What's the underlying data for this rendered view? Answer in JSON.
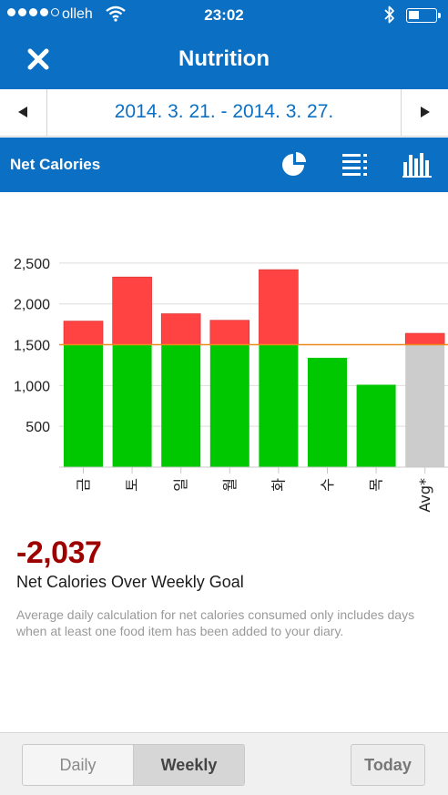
{
  "status": {
    "carrier": "olleh",
    "time": "23:02"
  },
  "nav": {
    "title": "Nutrition",
    "close_icon": "close-icon"
  },
  "date_range": {
    "label": "2014. 3. 21. - 2014. 3. 27.",
    "prev_icon": "chevron-left-icon",
    "next_icon": "chevron-right-icon"
  },
  "section": {
    "title": "Net Calories",
    "icons": [
      "pie-chart-icon",
      "list-icon",
      "bar-chart-icon"
    ]
  },
  "chart_data": {
    "type": "bar",
    "categories": [
      "금",
      "토",
      "일",
      "월",
      "화",
      "수",
      "목",
      "Avg*"
    ],
    "goal": 1500,
    "series": [
      {
        "name": "",
        "values": [
          1500,
          1500,
          1500,
          1500,
          1500,
          1340,
          1010,
          1500
        ]
      },
      {
        "name": "",
        "values": [
          290,
          830,
          380,
          300,
          920,
          0,
          0,
          140
        ]
      }
    ],
    "ylim": [
      0,
      2700
    ],
    "yticks": [
      500,
      1000,
      1500,
      2000,
      2500
    ],
    "ytick_labels": [
      "500",
      "1,000",
      "1,500",
      "2,000",
      "2,500"
    ],
    "colors": {
      "under_goal": "#00c800",
      "over_goal": "#ff4343",
      "average": "#cccccc",
      "goal_line": "#f08a1c"
    },
    "grid": true
  },
  "summary": {
    "value": "-2,037",
    "label": "Net Calories Over Weekly Goal",
    "note": "Average daily calculation for net calories consumed only includes days when at least one food item has been added to your diary."
  },
  "footer": {
    "daily": "Daily",
    "weekly": "Weekly",
    "today": "Today"
  },
  "colors": {
    "brand": "#0b6fc3",
    "negative_value": "#9e0000"
  }
}
